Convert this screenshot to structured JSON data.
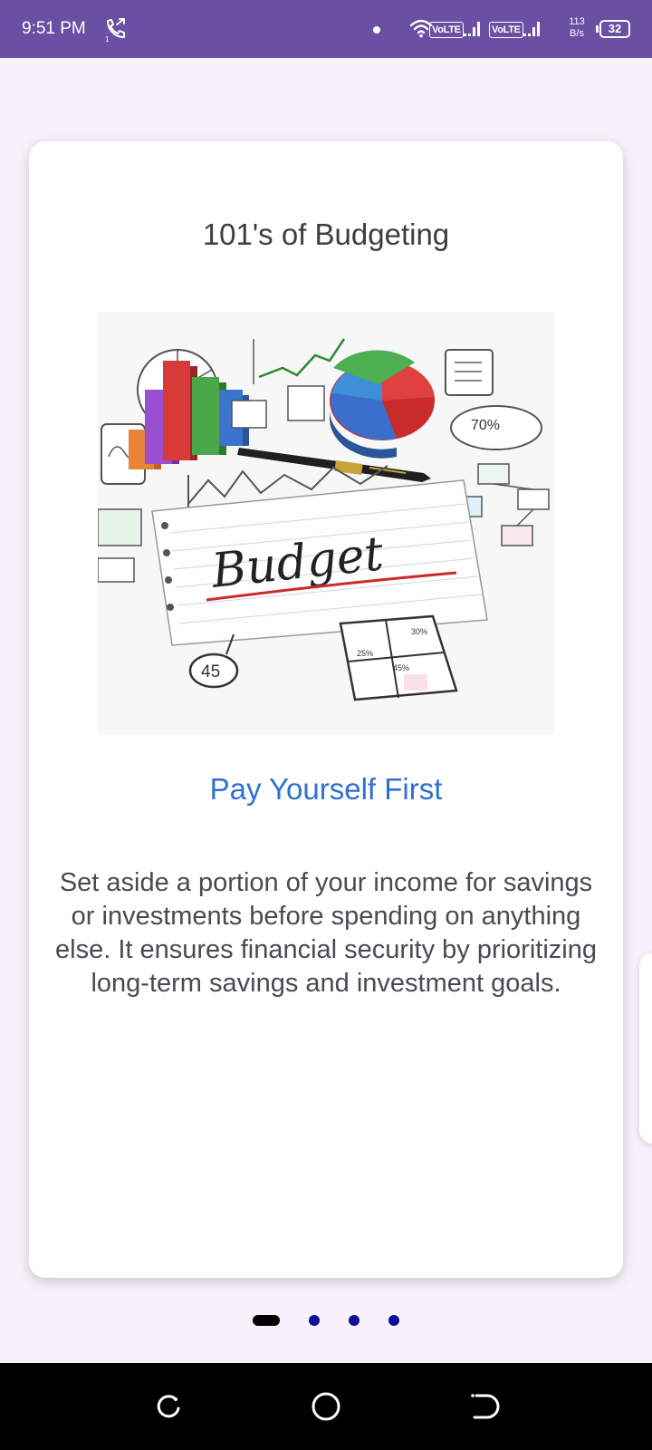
{
  "status_bar": {
    "time": "9:51 PM",
    "volte_1": "VoLTE",
    "volte_2": "VoLTE",
    "net_speed_value": "113",
    "net_speed_unit": "B/s",
    "battery_level": "32",
    "icons": [
      "call-forward-icon",
      "wifi-icon",
      "signal-icon",
      "battery-icon"
    ],
    "background_color": "#6a4fa3"
  },
  "card": {
    "title": "101's of Budgeting",
    "image_label": "Budget",
    "image_numbers": [
      "70%",
      "45",
      "25%",
      "30%",
      "45%"
    ],
    "subtitle": "Pay Yourself First",
    "body": "Set aside a portion of your income for savings or investments before spending on anything else. It ensures financial security by prioritizing long-term savings and investment goals.",
    "subtitle_color": "#2f6fd6"
  },
  "pager": {
    "total_pages": 4,
    "active_page": 1,
    "dot_color": "#0d0d9a"
  },
  "nav_bar": {
    "buttons": [
      "recents-icon",
      "home-icon",
      "back-icon"
    ]
  }
}
